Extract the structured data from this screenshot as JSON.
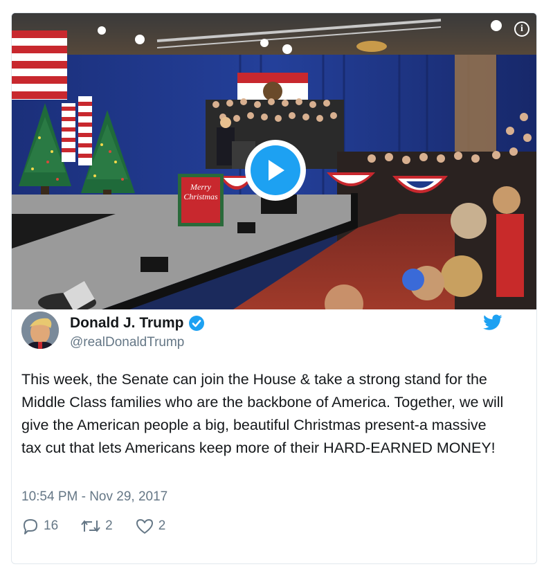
{
  "tweet": {
    "author_name": "Donald J. Trump",
    "author_handle": "@realDonaldTrump",
    "verified": true,
    "text": "This week, the Senate can join the House & take a strong stand for the Middle Class families who are the backbone of America. Together, we will give the American people a big, beautiful Christmas present-a massive tax cut that lets Americans keep more of their HARD-EARNED MONEY!",
    "timestamp": "10:54 PM - Nov 29, 2017",
    "replies": "16",
    "retweets": "2",
    "likes": "2"
  },
  "media": {
    "sign_line1": "Merry",
    "sign_line2": "Christmas",
    "info_glyph": "i"
  },
  "colors": {
    "brand_blue": "#1da1f2",
    "text_dark": "#14171a",
    "text_muted": "#657786",
    "border": "#e1e8ed"
  },
  "icons": [
    "info-icon",
    "play-icon",
    "verified-badge-icon",
    "twitter-bird-icon",
    "reply-icon",
    "retweet-icon",
    "like-icon"
  ]
}
